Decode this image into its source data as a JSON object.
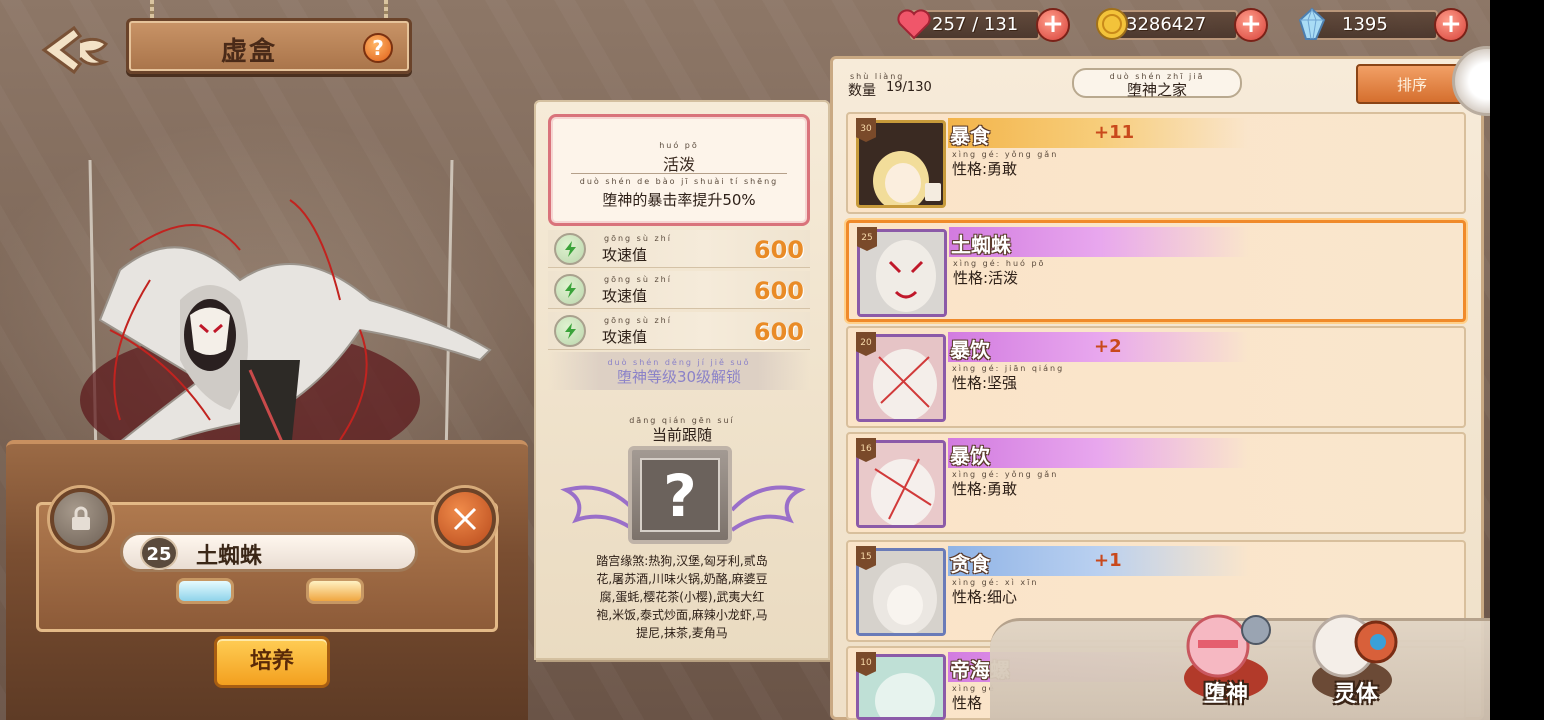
{
  "header": {
    "title": "虚盒",
    "help_label": "?"
  },
  "resources": [
    {
      "icon": "heart-icon",
      "value": "257 / 131",
      "plus": "+"
    },
    {
      "icon": "coin-icon",
      "value": "3286427",
      "plus": "+"
    },
    {
      "icon": "crystal-icon",
      "value": "1395",
      "plus": "+"
    }
  ],
  "selected": {
    "level": "25",
    "name": "土蜘蛛",
    "cultivate_label": "培养"
  },
  "trait": {
    "name_pinyin": "huó pō",
    "name": "活泼",
    "desc_pinyin": "duò shén de bào jī shuài tí shēng",
    "desc": "堕神的暴击率提升50%"
  },
  "stats": [
    {
      "pinyin": "gōng sù zhí",
      "label": "攻速值",
      "value": "600"
    },
    {
      "pinyin": "gōng sù zhí",
      "label": "攻速值",
      "value": "600"
    },
    {
      "pinyin": "gōng sù zhí",
      "label": "攻速值",
      "value": "600"
    }
  ],
  "unlock": {
    "pinyin": "duò shén děng jí jiě suǒ",
    "text": "堕神等级30级解锁"
  },
  "follow": {
    "pinyin": "dāng qián gēn suí",
    "label": "当前跟随",
    "placeholder": "?"
  },
  "description_lines": [
    "踏宫缘煞:热狗,汉堡,匈牙利,贰岛",
    "花,屠苏酒,川味火锅,奶酪,麻婆豆",
    "腐,蛋蚝,樱花茶(小樱),武夷大红",
    "袍,米饭,泰式炒面,麻辣小龙虾,马",
    "提尼,抹茶,麦角马"
  ],
  "list_header": {
    "count_pinyin": "shù liàng",
    "count_label": "数量",
    "count_value": "19/130",
    "home_pinyin": "duò shén zhī jiā",
    "home_label": "堕神之家",
    "sort_label": "排序"
  },
  "cards": [
    {
      "level": "30",
      "name": "暴食",
      "bonus": "+11",
      "nature_pinyin": "xìng gé: yǒng gǎn",
      "nature": "性格:勇敢",
      "ribbon": "gold",
      "locked": true
    },
    {
      "level": "25",
      "name": "土蜘蛛",
      "bonus": "",
      "nature_pinyin": "xìng gé: huó pō",
      "nature": "性格:活泼",
      "ribbon": "purple",
      "locked": false
    },
    {
      "level": "20",
      "name": "暴饮",
      "bonus": "+2",
      "nature_pinyin": "xìng gé: jiān qiáng",
      "nature": "性格:坚强",
      "ribbon": "purple",
      "locked": false
    },
    {
      "level": "16",
      "name": "暴饮",
      "bonus": "",
      "nature_pinyin": "xìng gé: yǒng gǎn",
      "nature": "性格:勇敢",
      "ribbon": "purple",
      "locked": false
    },
    {
      "level": "15",
      "name": "贪食",
      "bonus": "+1",
      "nature_pinyin": "xìng gé: xì xīn",
      "nature": "性格:细心",
      "ribbon": "blue",
      "locked": false
    },
    {
      "level": "10",
      "name": "帝海螺",
      "bonus": "",
      "nature_pinyin": "xìng gé",
      "nature": "性格",
      "ribbon": "purple",
      "locked": false
    }
  ],
  "bottom_nav": [
    {
      "label": "堕神"
    },
    {
      "label": "灵体"
    }
  ],
  "colors": {
    "accent": "#f3a01f",
    "selected_border": "#f08a2a",
    "stat_value": "#e98b26",
    "bonus": "#c9491c"
  }
}
